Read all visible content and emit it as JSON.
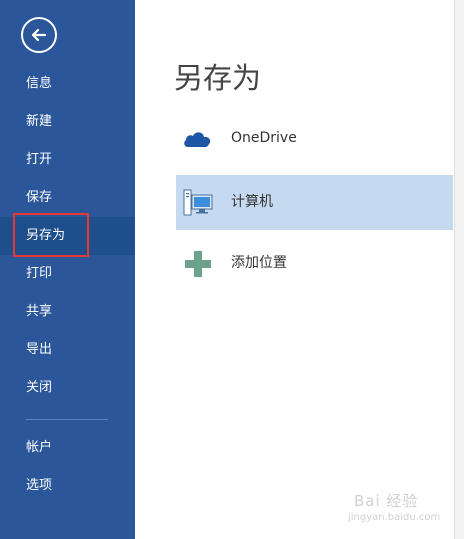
{
  "nav": {
    "items": [
      {
        "label": "信息"
      },
      {
        "label": "新建"
      },
      {
        "label": "打开"
      },
      {
        "label": "保存"
      },
      {
        "label": "另存为"
      },
      {
        "label": "打印"
      },
      {
        "label": "共享"
      },
      {
        "label": "导出"
      },
      {
        "label": "关闭"
      },
      {
        "label": "帐户"
      },
      {
        "label": "选项"
      }
    ],
    "active": "另存为"
  },
  "main": {
    "title": "另存为",
    "locations": [
      {
        "label": "OneDrive",
        "icon": "cloud-icon"
      },
      {
        "label": "计算机",
        "icon": "computer-icon",
        "selected": true
      },
      {
        "label": "添加位置",
        "icon": "plus-icon"
      }
    ]
  },
  "watermark": {
    "text": "Bai 经验",
    "sub": "jingyan.baidu.com"
  },
  "colors": {
    "nav_bg": "#2b579a",
    "nav_active": "#1e4e8c",
    "selected_bg": "#c5d9f1",
    "highlight_border": "#e53935",
    "onedrive_blue": "#1e56a6",
    "plus_green": "#6aa38a"
  }
}
